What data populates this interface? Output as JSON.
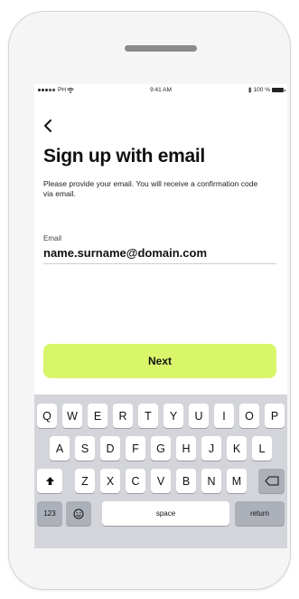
{
  "status_bar": {
    "carrier": "PH",
    "time": "9:41 AM",
    "battery": "100 %"
  },
  "header": {
    "back_icon": "chevron-left-icon",
    "title": "Sign up with email",
    "description": "Please provide your email. You will receive a confirmation code via email."
  },
  "form": {
    "email_label": "Email",
    "email_value": "name.surname@domain.com"
  },
  "actions": {
    "next_label": "Next",
    "next_color": "#d9f56a"
  },
  "keyboard": {
    "row1": [
      "Q",
      "W",
      "E",
      "R",
      "T",
      "Y",
      "U",
      "I",
      "O",
      "P"
    ],
    "row2": [
      "A",
      "S",
      "D",
      "F",
      "G",
      "H",
      "J",
      "K",
      "L"
    ],
    "row3": [
      "Z",
      "X",
      "C",
      "V",
      "B",
      "N",
      "M"
    ],
    "numbers_label": "123",
    "space_label": "space",
    "return_label": "return",
    "shift_icon": "shift-icon",
    "delete_icon": "delete-icon",
    "emoji_icon": "emoji-icon"
  }
}
